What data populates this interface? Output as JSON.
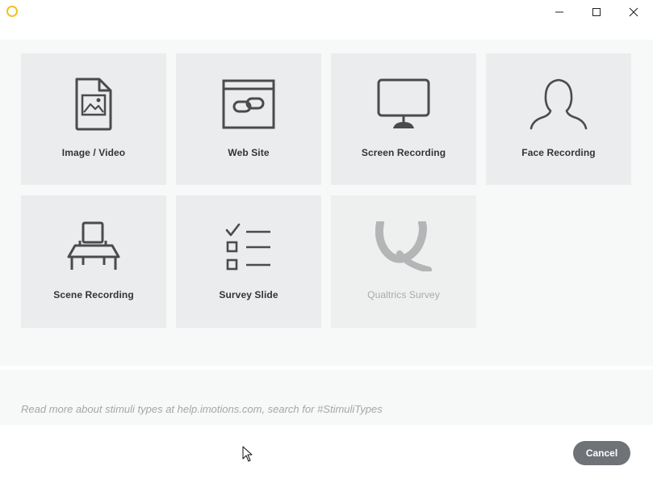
{
  "window": {
    "controls": {
      "minimize_icon": "minimize-icon",
      "maximize_icon": "maximize-icon",
      "close_icon": "close-icon"
    },
    "logo_color": "#f2c21b"
  },
  "tiles": [
    {
      "label": "Image / Video",
      "icon": "image-file-icon",
      "enabled": true
    },
    {
      "label": "Web Site",
      "icon": "web-link-icon",
      "enabled": true
    },
    {
      "label": "Screen Recording",
      "icon": "monitor-icon",
      "enabled": true
    },
    {
      "label": "Face Recording",
      "icon": "person-silhouette-icon",
      "enabled": true
    },
    {
      "label": "Scene Recording",
      "icon": "desk-icon",
      "enabled": true
    },
    {
      "label": "Survey Slide",
      "icon": "checklist-icon",
      "enabled": true
    },
    {
      "label": "Qualtrics Survey",
      "icon": "qualtrics-q-icon",
      "enabled": false
    }
  ],
  "help": {
    "text": "Read more about stimuli types at help.imotions.com, search for #StimuliTypes"
  },
  "footer": {
    "cancel_label": "Cancel",
    "cancel_color": "#6f7378"
  }
}
